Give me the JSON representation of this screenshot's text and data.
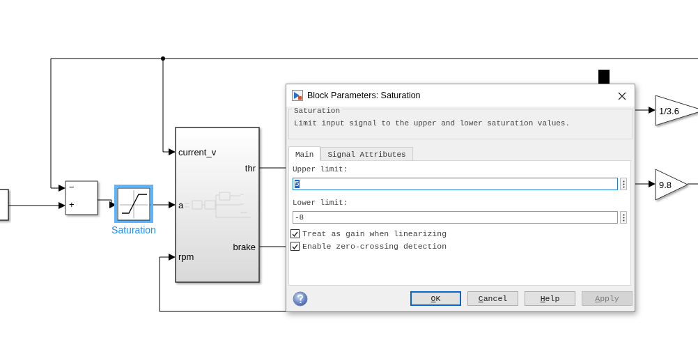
{
  "diagram": {
    "sum_block": {
      "signs": [
        "−",
        "+"
      ]
    },
    "saturation_block": {
      "label": "Saturation",
      "selected": true
    },
    "subsystem": {
      "inputs": [
        "current_v",
        "a",
        "rpm"
      ],
      "outputs": [
        "thr",
        "brake"
      ]
    },
    "gains": [
      {
        "label": "1/3.6"
      },
      {
        "label": "9.8"
      }
    ]
  },
  "dialog": {
    "title": "Block Parameters: Saturation",
    "group": {
      "title": "Saturation",
      "description": "Limit input signal to the upper and lower saturation values."
    },
    "tabs": [
      {
        "label": "Main",
        "selected": true
      },
      {
        "label": "Signal Attributes",
        "selected": false
      }
    ],
    "fields": [
      {
        "label": "Upper limit:",
        "value": "5",
        "focused": true,
        "text_selected": true
      },
      {
        "label": "Lower limit:",
        "value": "-8",
        "focused": false,
        "text_selected": false
      }
    ],
    "checkboxes": [
      {
        "label": "Treat as gain when linearizing",
        "checked": true
      },
      {
        "label": "Enable zero-crossing detection",
        "checked": true
      }
    ],
    "buttons": [
      {
        "mnemonic": "O",
        "rest": "K",
        "focused": true,
        "disabled": false
      },
      {
        "mnemonic": "C",
        "rest": "ancel",
        "focused": false,
        "disabled": false
      },
      {
        "mnemonic": "H",
        "rest": "elp",
        "focused": false,
        "disabled": false
      },
      {
        "mnemonic": "A",
        "rest": "pply",
        "focused": false,
        "disabled": true
      }
    ]
  }
}
